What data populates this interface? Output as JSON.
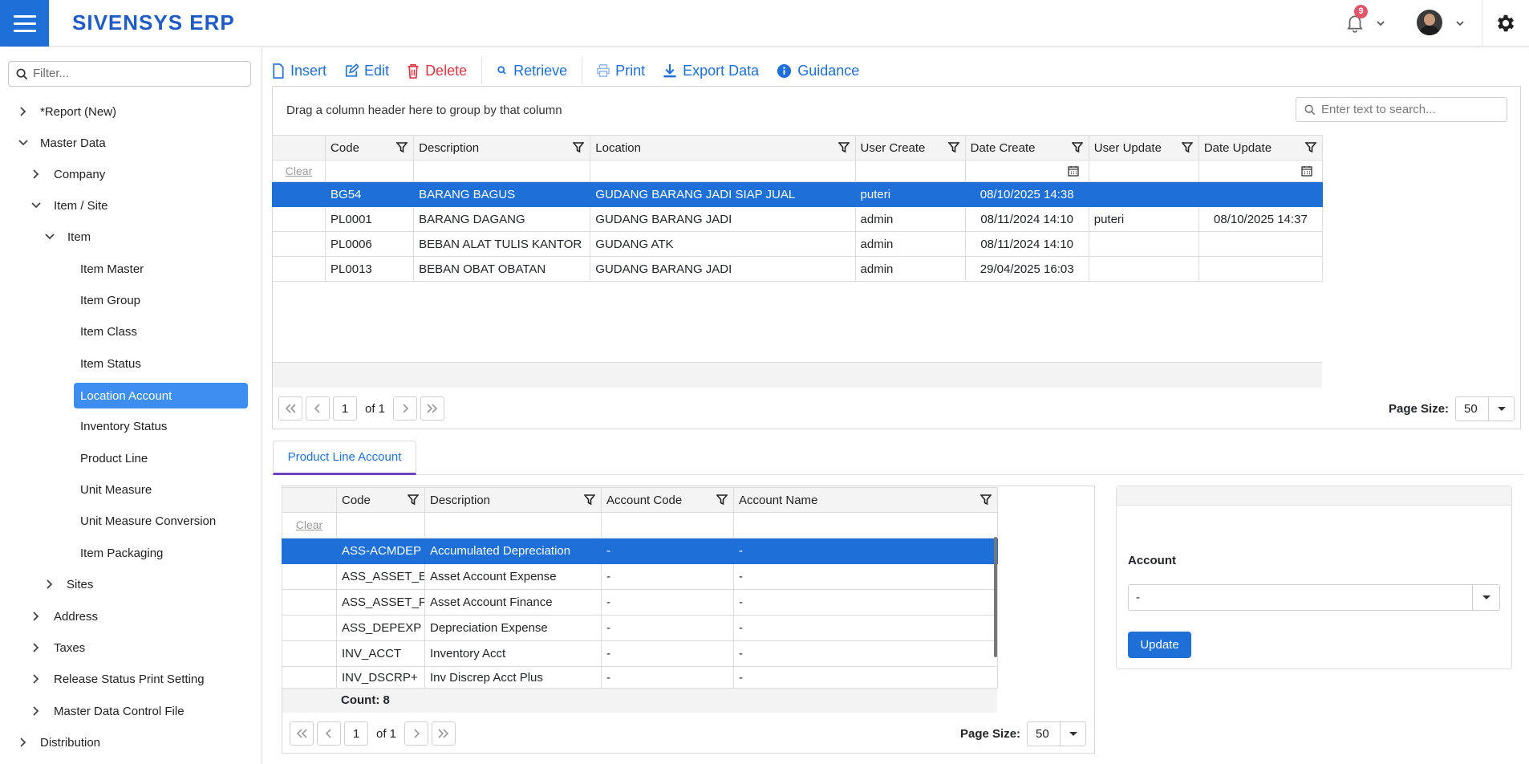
{
  "app": {
    "logo_main": "SIVENSYS ",
    "logo_erp": "ERP",
    "notification_count": "9"
  },
  "sidebar": {
    "filter_placeholder": "Filter...",
    "items": [
      {
        "label": "*Report (New)"
      },
      {
        "label": "Master Data"
      },
      {
        "label": "Company"
      },
      {
        "label": "Item / Site"
      },
      {
        "label": "Item"
      },
      {
        "label": "Item Master"
      },
      {
        "label": "Item Group"
      },
      {
        "label": "Item Class"
      },
      {
        "label": "Item Status"
      },
      {
        "label": "Location Account"
      },
      {
        "label": "Inventory Status"
      },
      {
        "label": "Product Line"
      },
      {
        "label": "Unit Measure"
      },
      {
        "label": "Unit Measure Conversion"
      },
      {
        "label": "Item Packaging"
      },
      {
        "label": "Sites"
      },
      {
        "label": "Address"
      },
      {
        "label": "Taxes"
      },
      {
        "label": "Release Status Print Setting"
      },
      {
        "label": "Master Data Control File"
      },
      {
        "label": "Distribution"
      }
    ]
  },
  "toolbar": {
    "insert": "Insert",
    "edit": "Edit",
    "delete": "Delete",
    "retrieve": "Retrieve",
    "print": "Print",
    "export": "Export Data",
    "guidance": "Guidance"
  },
  "main_grid": {
    "group_hint": "Drag a column header here to group by that column",
    "search_placeholder": "Enter text to search...",
    "clear": "Clear",
    "columns": [
      "Code",
      "Description",
      "Location",
      "User Create",
      "Date Create",
      "User Update",
      "Date Update"
    ],
    "rows": [
      [
        "BG54",
        "BARANG BAGUS",
        "GUDANG BARANG JADI SIAP JUAL",
        "puteri",
        "08/10/2025 14:38",
        "",
        ""
      ],
      [
        "PL0001",
        "BARANG DAGANG",
        "GUDANG BARANG JADI",
        "admin",
        "08/11/2024 14:10",
        "puteri",
        "08/10/2025 14:37"
      ],
      [
        "PL0006",
        "BEBAN ALAT TULIS KANTOR",
        "GUDANG ATK",
        "admin",
        "08/11/2024 14:10",
        "",
        ""
      ],
      [
        "PL0013",
        "BEBAN OBAT OBATAN",
        "GUDANG BARANG JADI",
        "admin",
        "29/04/2025 16:03",
        "",
        ""
      ]
    ],
    "page": "1",
    "of_text": "of 1",
    "page_size_label": "Page Size:",
    "page_size": "50"
  },
  "tab": {
    "label": "Product Line Account"
  },
  "sub_grid": {
    "clear": "Clear",
    "columns": [
      "Code",
      "Description",
      "Account Code",
      "Account Name"
    ],
    "rows": [
      [
        "ASS-ACMDEP",
        "Accumulated Depreciation",
        "-",
        "-"
      ],
      [
        "ASS_ASSET_E",
        "Asset Account Expense",
        "-",
        "-"
      ],
      [
        "ASS_ASSET_F",
        "Asset Account Finance",
        "-",
        "-"
      ],
      [
        "ASS_DEPEXP",
        "Depreciation Expense",
        "-",
        "-"
      ],
      [
        "INV_ACCT",
        "Inventory Acct",
        "-",
        "-"
      ],
      [
        "INV_DSCRP+",
        "Inv Discrep Acct Plus",
        "-",
        "-"
      ]
    ],
    "count": "Count: 8",
    "page": "1",
    "of_text": "of 1",
    "page_size_label": "Page Size:",
    "page_size": "50"
  },
  "account_panel": {
    "label": "Account",
    "value": "-",
    "update_button": "Update"
  }
}
